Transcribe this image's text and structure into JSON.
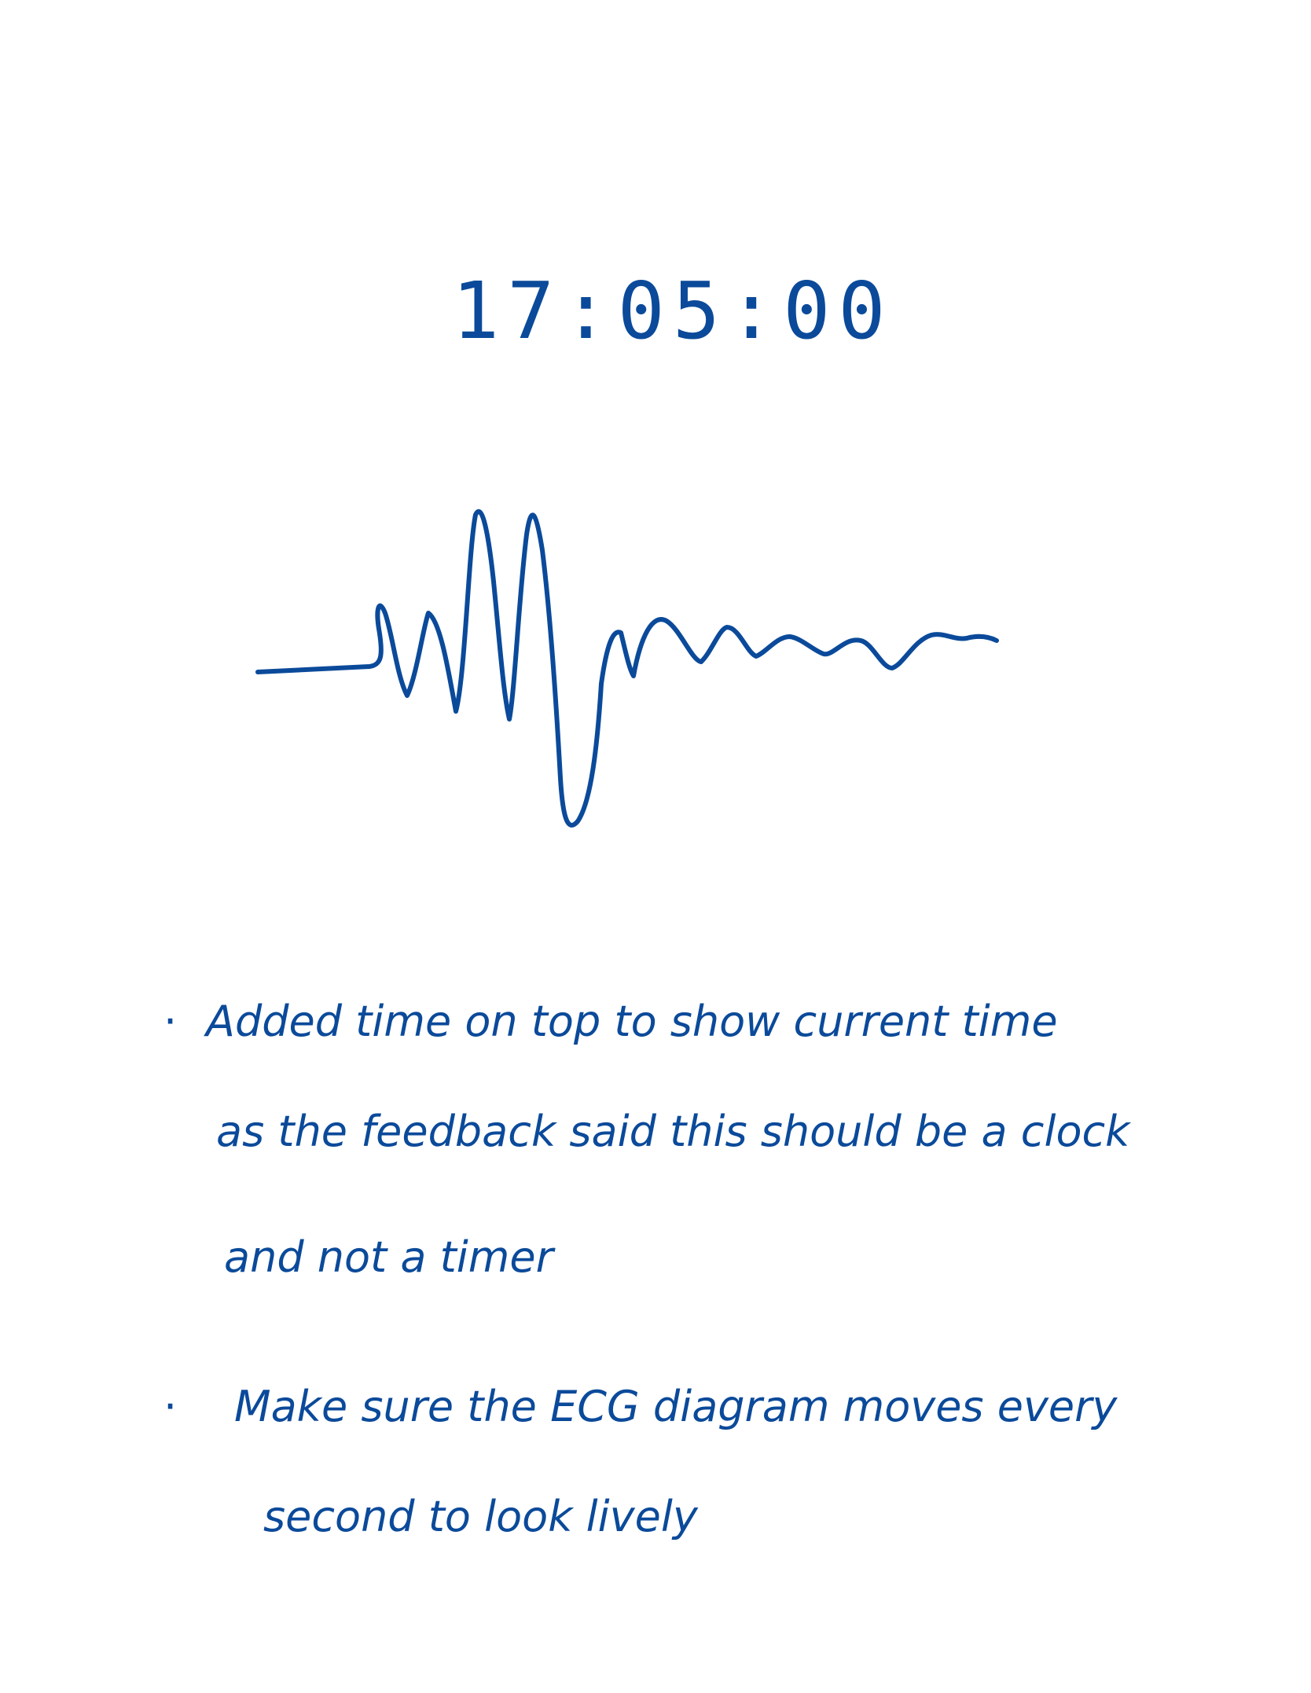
{
  "ink_color": "#0b4a9a",
  "clock": {
    "time": "17:05:00"
  },
  "waveform": {
    "icon": "ecg-waveform-icon"
  },
  "notes": [
    {
      "bullet": "·",
      "lines": [
        "Added time on top to show current time",
        "as the feedback said this should be a clock",
        "and not a timer"
      ]
    },
    {
      "bullet": "·",
      "lines": [
        "Make sure the ECG diagram moves every",
        "second to look lively"
      ]
    }
  ]
}
